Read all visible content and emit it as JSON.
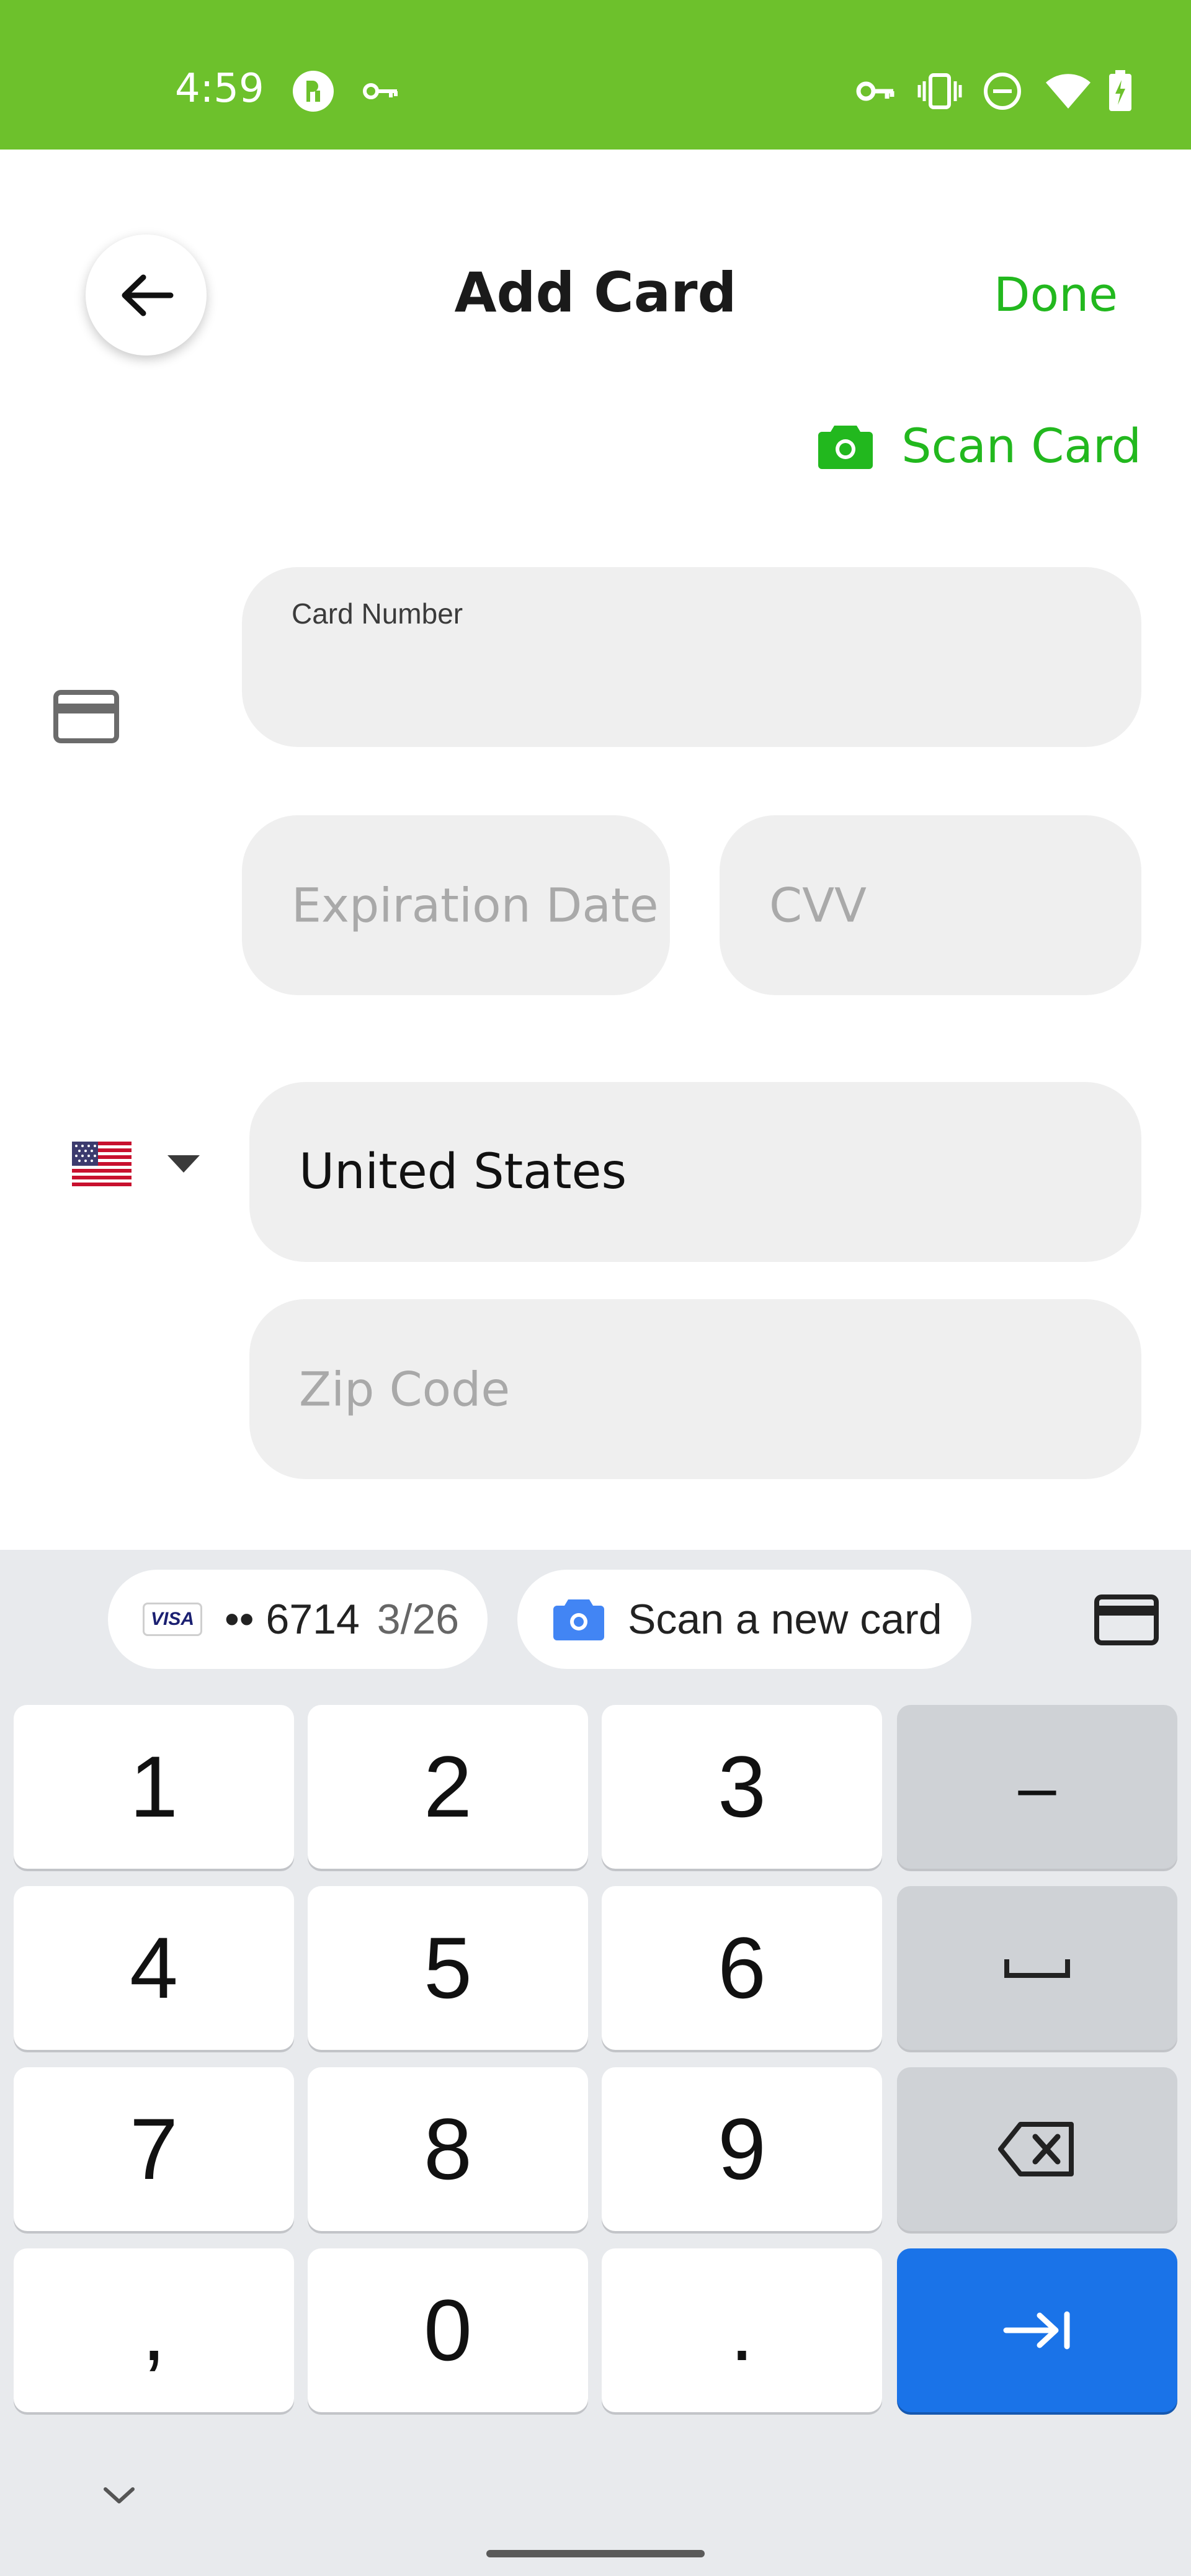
{
  "status_bar": {
    "time": "4:59",
    "background": "#6dc12c",
    "icons": [
      "app-icon",
      "key-icon",
      "vpn-key-icon",
      "vibrate-icon",
      "do-not-disturb-icon",
      "wifi-icon",
      "battery-icon"
    ]
  },
  "header": {
    "title": "Add Card",
    "done_label": "Done"
  },
  "scan_card": {
    "label": "Scan Card"
  },
  "form": {
    "card_number_label": "Card Number",
    "expiration_placeholder": "Expiration Date",
    "cvv_placeholder": "CVV",
    "country_value": "United States",
    "zip_placeholder": "Zip Code"
  },
  "keyboard": {
    "suggestions": {
      "saved_card_brand": "VISA",
      "saved_card_number": "•• 6714",
      "saved_card_expiry": "3/26",
      "scan_new_card": "Scan a new card"
    },
    "keys": {
      "k1": "1",
      "k2": "2",
      "k3": "3",
      "k4": "4",
      "k5": "5",
      "k6": "6",
      "k7": "7",
      "k8": "8",
      "k9": "9",
      "comma": ",",
      "k0": "0",
      "period": ".",
      "minus": "–"
    }
  },
  "colors": {
    "accent": "#22b81e",
    "key_action": "#1a73e8",
    "field_bg": "#efefef"
  }
}
